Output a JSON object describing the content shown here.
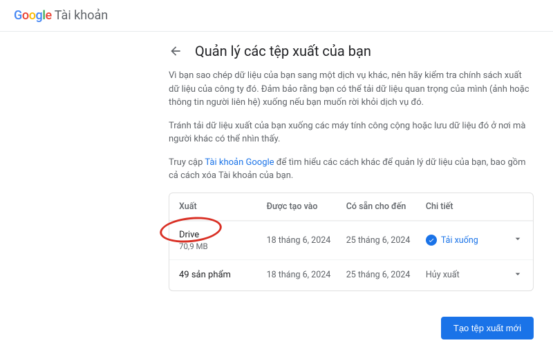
{
  "header": {
    "logo_letters": [
      "G",
      "o",
      "o",
      "g",
      "l",
      "e"
    ],
    "product_name": "Tài khoản"
  },
  "page": {
    "title": "Quản lý các tệp xuất của bạn",
    "para1": "Vì bạn sao chép dữ liệu của bạn sang một dịch vụ khác, nên hãy kiểm tra chính sách xuất dữ liệu của công ty đó. Đảm bảo rằng bạn có thể tải dữ liệu quan trọng của mình (ảnh hoặc thông tin người liên hệ) xuống nếu bạn muốn rời khỏi dịch vụ đó.",
    "para2": "Tránh tải dữ liệu xuất của bạn xuống các máy tính công cộng hoặc lưu dữ liệu đó ở nơi mà người khác có thể nhìn thấy.",
    "para3_pre": "Truy cập ",
    "para3_link": "Tài khoản Google",
    "para3_post": " để tìm hiểu các cách khác để quản lý dữ liệu của bạn, bao gồm cả cách xóa Tài khoản của bạn."
  },
  "table": {
    "headers": {
      "export": "Xuất",
      "created": "Được tạo vào",
      "available_until": "Có sẵn cho đến",
      "details": "Chi tiết"
    },
    "rows": [
      {
        "product": "Drive",
        "subtext": "70,9 MB",
        "created": "18 tháng 6, 2024",
        "available_until": "25 tháng 6, 2024",
        "action_label": "Tải xuống",
        "action_type": "download"
      },
      {
        "product": "49 sản phẩm",
        "subtext": "",
        "created": "18 tháng 6, 2024",
        "available_until": "25 tháng 6, 2024",
        "action_label": "Hủy xuất",
        "action_type": "cancel"
      }
    ]
  },
  "footer": {
    "primary_button": "Tạo tệp xuất mới"
  }
}
